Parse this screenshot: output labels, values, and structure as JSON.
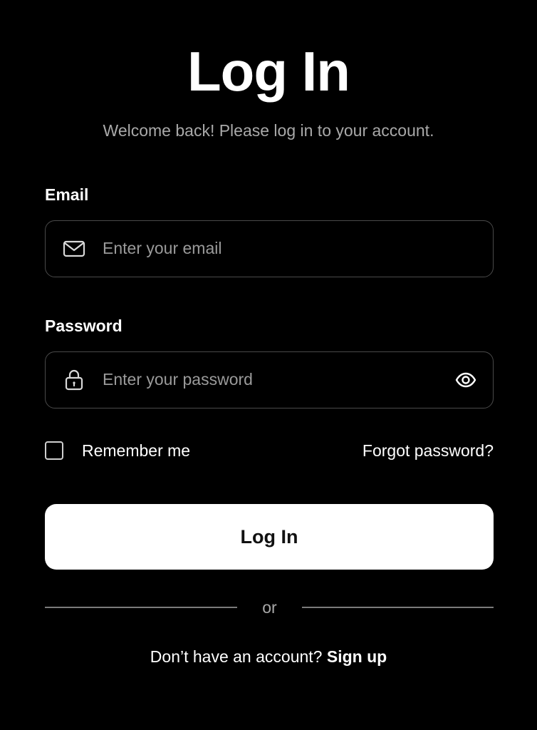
{
  "page": {
    "title": "Log In",
    "subtitle": "Welcome back! Please log in to your account."
  },
  "form": {
    "email": {
      "label": "Email",
      "placeholder": "Enter your email",
      "value": "",
      "icon": "mail-icon"
    },
    "password": {
      "label": "Password",
      "placeholder": "Enter your password",
      "value": "",
      "icon": "lock-icon",
      "toggle_icon": "eye-icon"
    },
    "remember_me": {
      "label": "Remember me",
      "checked": false
    },
    "forgot_password_label": "Forgot password?",
    "submit_label": "Log In"
  },
  "divider": {
    "text": "or"
  },
  "signup": {
    "prompt": "Don’t have an account?",
    "link_label": "Sign up"
  },
  "colors": {
    "background": "#000000",
    "button_background": "#ffffff",
    "button_text": "#111111",
    "muted_text": "#a9a9a9",
    "field_border": "#4a4a4a"
  }
}
